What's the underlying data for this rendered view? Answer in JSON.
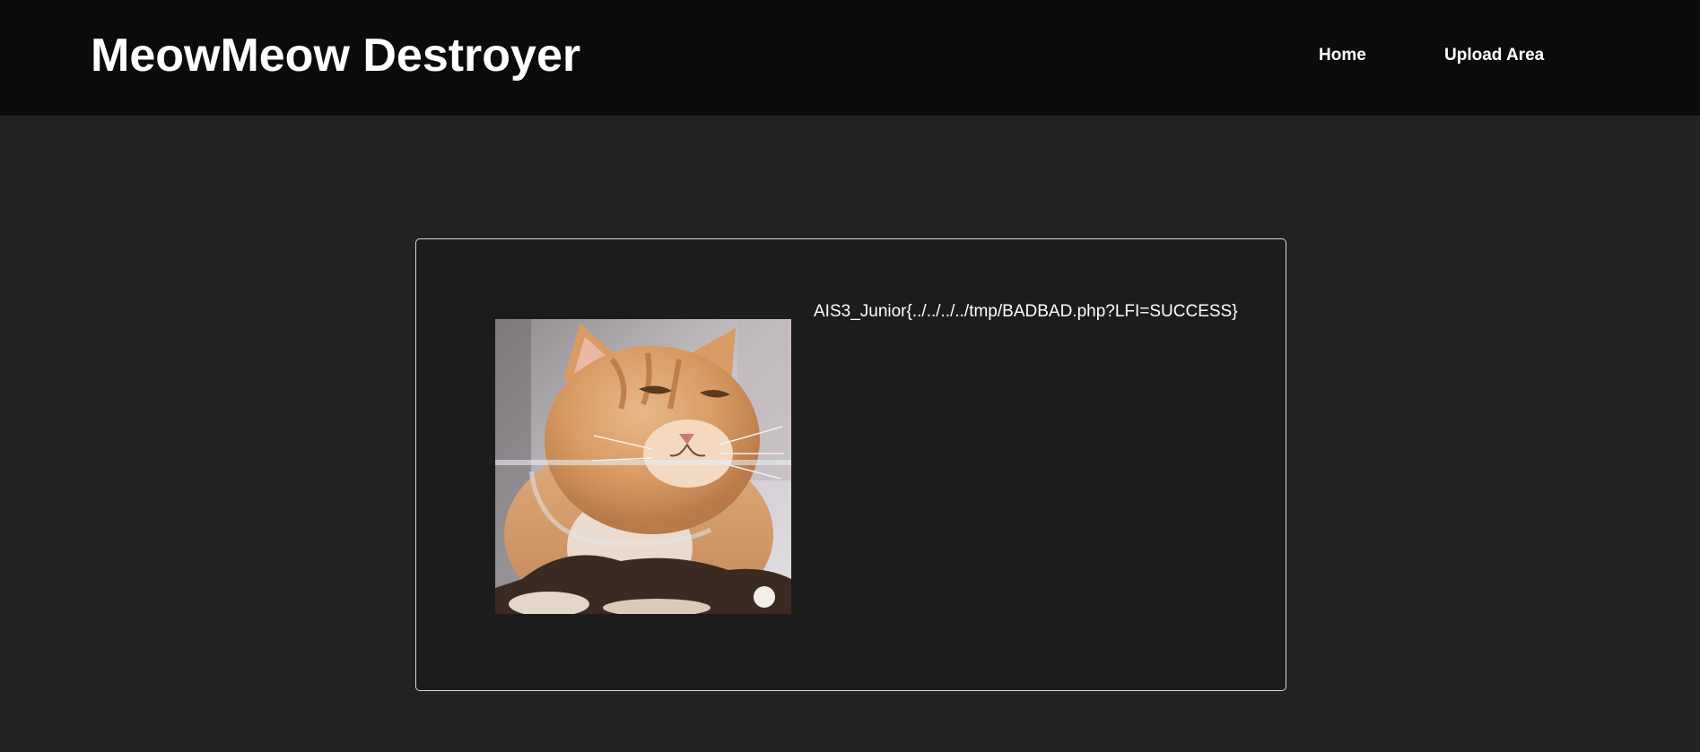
{
  "header": {
    "title": "MeowMeow Destroyer",
    "nav": [
      {
        "label": "Home"
      },
      {
        "label": "Upload Area"
      }
    ]
  },
  "card": {
    "image_icon": "cat-photo",
    "text": "AIS3_Junior{../../../../tmp/BADBAD.php?LFI=SUCCESS}"
  }
}
